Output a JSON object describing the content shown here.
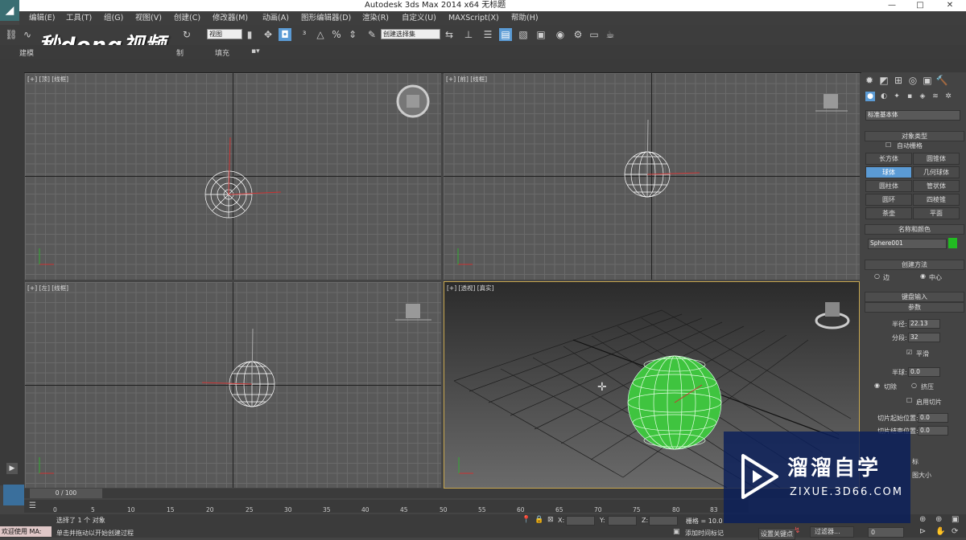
{
  "window": {
    "title": "Autodesk 3ds Max  2014 x64     无标题",
    "minimize": "—",
    "maximize": "□",
    "close": "✕"
  },
  "menu": [
    "编辑(E)",
    "工具(T)",
    "组(G)",
    "视图(V)",
    "创建(C)",
    "修改器(M)",
    "动画(A)",
    "图形编辑器(D)",
    "渲染(R)",
    "自定义(U)",
    "MAXScript(X)",
    "帮助(H)"
  ],
  "toolbar": {
    "view_dropdown": "视图",
    "selection_set": "创建选择集"
  },
  "ribbon": {
    "items": [
      "建模",
      "填充"
    ],
    "item_mid": "制"
  },
  "watermark_top": "秒dong视频",
  "viewports": {
    "top_label": "[+] [顶] [线框]",
    "front_label": "[+] [前] [线框]",
    "left_label": "[+] [左] [线框]",
    "persp_label": "[+] [透视] [真实]"
  },
  "command_panel": {
    "dropdown": "标准基本体",
    "object_type_header": "对象类型",
    "autogrid": "自动栅格",
    "buttons": [
      "长方体",
      "圆锥体",
      "球体",
      "几何球体",
      "圆柱体",
      "管状体",
      "圆环",
      "四棱锥",
      "茶壶",
      "平面"
    ],
    "active_button": "球体",
    "name_color_header": "名称和颜色",
    "object_name": "Sphere001",
    "object_color": "#22bb22",
    "creation_method_header": "创建方法",
    "method_edge": "边",
    "method_center": "中心",
    "keyboard_entry_header": "键盘输入",
    "params_header": "参数",
    "radius_label": "半径:",
    "radius_value": "22.13",
    "segments_label": "分段:",
    "segments_value": "32",
    "smooth_label": "平滑",
    "hemisphere_label": "半球:",
    "hemisphere_value": "0.0",
    "chop_label": "切除",
    "squash_label": "挤压",
    "slice_on_label": "启用切片",
    "slice_from_label": "切片起始位置:",
    "slice_from_value": "0.0",
    "slice_to_label": "切片结束位置:",
    "slice_to_value": "0.0",
    "partial_1": "标",
    "partial_2": "图大小"
  },
  "timeline": {
    "slider": "0 / 100",
    "ticks": [
      "0",
      "5",
      "10",
      "15",
      "20",
      "25",
      "30",
      "35",
      "40",
      "45",
      "50",
      "55",
      "60",
      "65",
      "70",
      "75",
      "80",
      "83"
    ]
  },
  "status": {
    "welcome": "欢迎使用 MA:",
    "selected": "选择了 1 个 对象",
    "prompt": "单击并拖动以开始创建过程",
    "x_label": "X:",
    "y_label": "Y:",
    "z_label": "Z:",
    "grid": "栅格 = 10.0",
    "add_time_tag": "添加时间标记",
    "set_key": "设置关键点",
    "filters": "过滤器...",
    "frame": "0"
  },
  "watermark_bottom": {
    "title": "溜溜自学",
    "url": "ZIXUE.3D66.COM"
  }
}
